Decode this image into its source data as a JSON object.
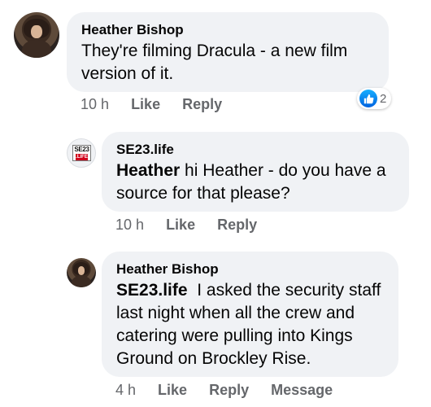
{
  "comments": [
    {
      "author": "Heather Bishop",
      "text": "They're filming Dracula - a new film version of it.",
      "time": "10 h",
      "actions": [
        "Like",
        "Reply"
      ],
      "reaction": {
        "icon": "like-icon",
        "count": "2"
      }
    },
    {
      "author": "SE23.life",
      "avatar_logo": {
        "top": "SE23",
        "bottom": ".LIFE"
      },
      "mention": "Heather",
      "text": "hi Heather - do you have a source for that please?",
      "time": "10 h",
      "actions": [
        "Like",
        "Reply"
      ]
    },
    {
      "author": "Heather Bishop",
      "mention": "SE23.life",
      "text": "I asked the security staff last night when all the crew and catering were pulling into Kings Ground on Brockley Rise.",
      "time": "4 h",
      "actions": [
        "Like",
        "Reply",
        "Message"
      ]
    }
  ],
  "colors": {
    "bubble": "#f0f2f5",
    "meta_text": "#65676b",
    "like_blue": "#1877f2"
  }
}
